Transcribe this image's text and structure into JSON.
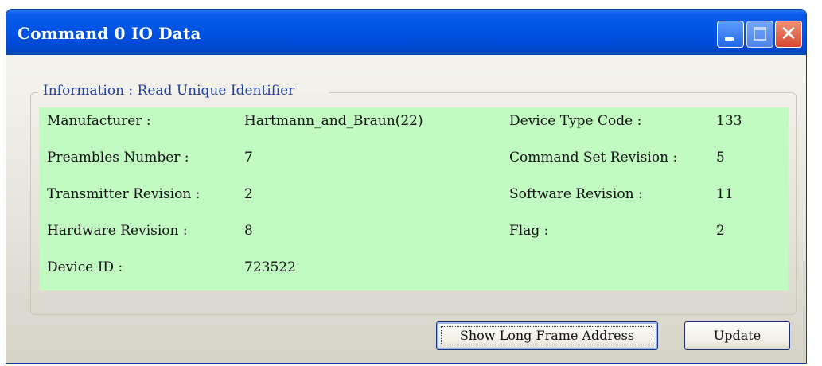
{
  "window": {
    "title": "Command 0 IO Data",
    "controls": {
      "minimize": "minimize-icon",
      "maximize": "maximize-icon",
      "close": "close-icon"
    }
  },
  "group": {
    "legend": "Information : Read Unique Identifier",
    "fields": {
      "manufacturer": {
        "label": "Manufacturer :",
        "value": "Hartmann_and_Braun(22)"
      },
      "device_type_code": {
        "label": "Device Type Code :",
        "value": "133"
      },
      "preambles_number": {
        "label": "Preambles Number :",
        "value": "7"
      },
      "command_set_revision": {
        "label": "Command Set Revision :",
        "value": "5"
      },
      "transmitter_revision": {
        "label": "Transmitter Revision :",
        "value": "2"
      },
      "software_revision": {
        "label": "Software Revision :",
        "value": "11"
      },
      "hardware_revision": {
        "label": "Hardware Revision :",
        "value": "8"
      },
      "flag": {
        "label": "Flag :",
        "value": "2"
      },
      "device_id": {
        "label": "Device ID :",
        "value": "723522"
      }
    }
  },
  "buttons": {
    "show_long_frame": "Show Long Frame Address",
    "update": "Update"
  },
  "colors": {
    "title_bar": "#0055e5",
    "panel_bg": "#c1fbc2",
    "legend_text": "#1f3f9d"
  }
}
